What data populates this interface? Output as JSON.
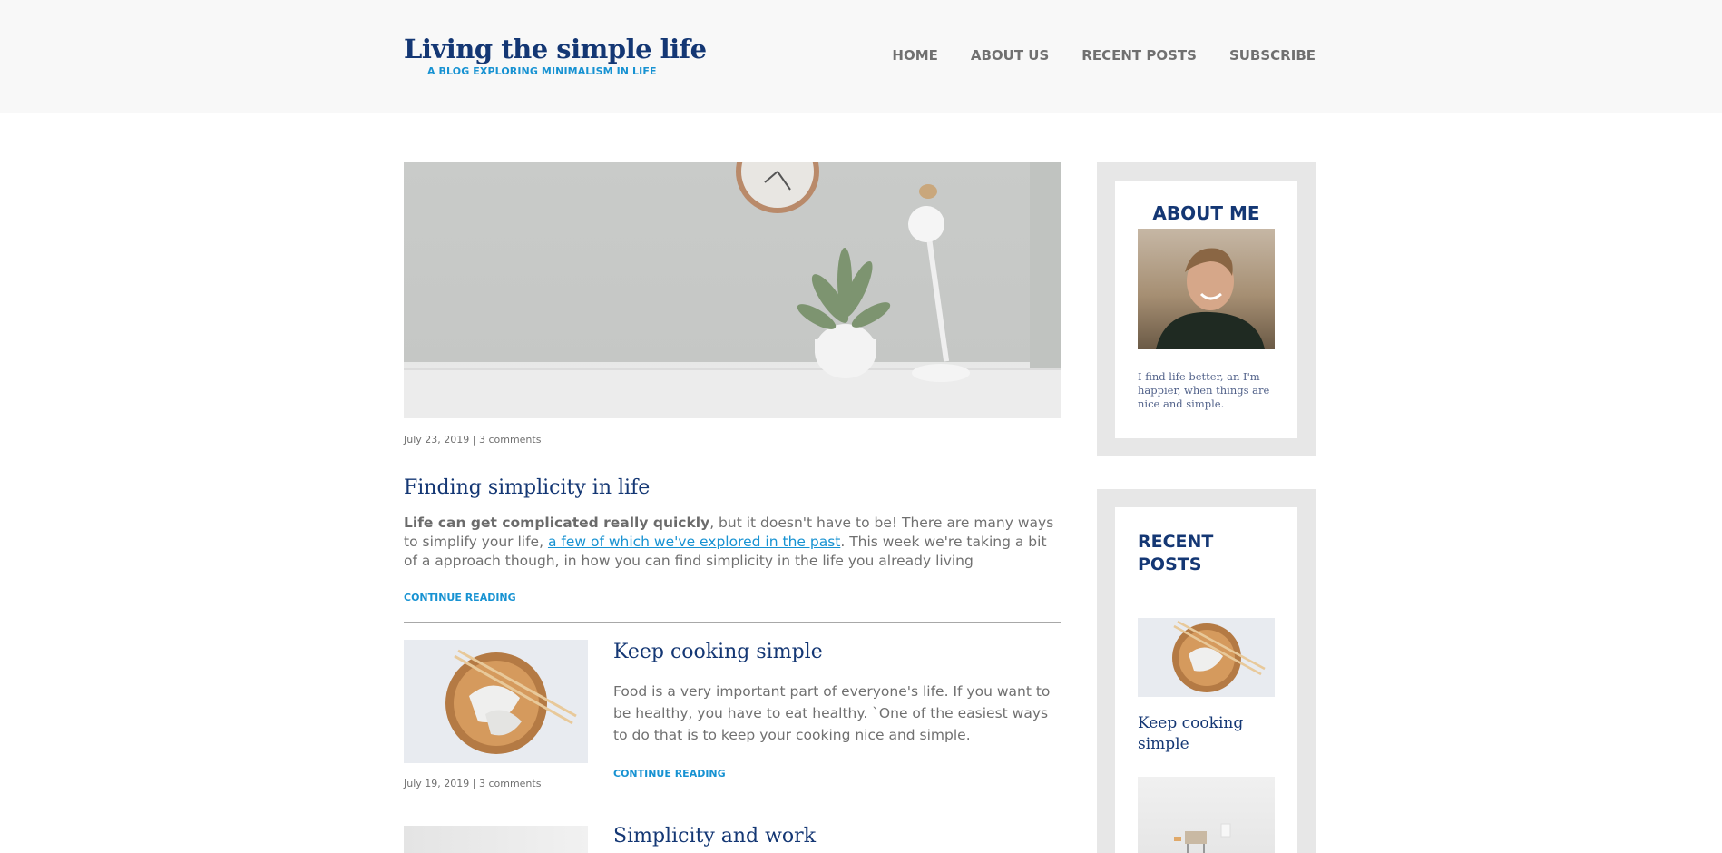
{
  "header": {
    "title": "Living the simple life",
    "subtitle": "A blog exploring minimalism in life",
    "nav": [
      "Home",
      "About us",
      "Recent posts",
      "Subscribe"
    ]
  },
  "featured_post": {
    "meta": "July 23, 2019 | 3 comments",
    "title": "Finding simplicity in life",
    "excerpt_bold": "Life can get complicated really quickly",
    "excerpt_part1": ", but it doesn't have to be! There are many ways to simplify your life, ",
    "excerpt_link": "a few of which we've explored in the past",
    "excerpt_part2": ". This week we're taking a bit of a approach though, in how you can find simplicity in the life you already living",
    "continue": "Continue reading"
  },
  "posts": [
    {
      "title": "Keep cooking simple",
      "excerpt": "Food is a very important part of everyone's life. If you want to be healthy, you have to eat healthy. `One of the easiest ways to do that is to keep your cooking nice and simple.",
      "meta": "July 19, 2019 | 3 comments",
      "continue": "Continue reading"
    },
    {
      "title": "Simplicity and work"
    }
  ],
  "sidebar": {
    "about": {
      "title": "About me",
      "text": "I find life better, an I'm happier, when things are nice and simple."
    },
    "recent": {
      "title": "Recent posts",
      "items": [
        {
          "label": "Keep cooking simple"
        }
      ]
    }
  },
  "colors": {
    "brand": "#143774",
    "accent": "#1792d2",
    "header_bg": "#f8f8f8",
    "widget_bg": "#e7e7e7"
  }
}
